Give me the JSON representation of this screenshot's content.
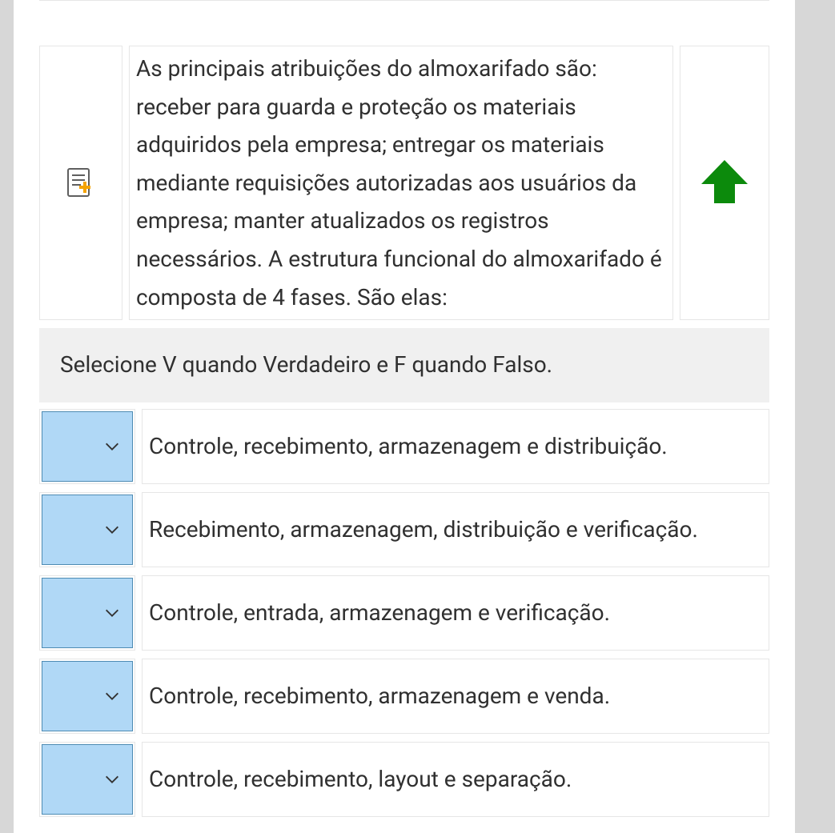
{
  "question": {
    "text": "As principais atribuições do almoxarifado são: receber para guarda e proteção os materiais adquiridos pela empresa; entregar os materiais mediante requisições autorizadas aos usuários da empresa; manter atualizados os registros necessários. A estrutura funcional do almoxarifado é composta de 4 fases. São elas:"
  },
  "instruction": "Selecione V quando Verdadeiro e F quando Falso.",
  "options": [
    {
      "text": "Controle, recebimento, armazenagem e distribuição."
    },
    {
      "text": "Recebimento, armazenagem, distribuição e verificação."
    },
    {
      "text": "Controle, entrada, armazenagem e verificação."
    },
    {
      "text": "Controle, recebimento, armazenagem e venda."
    },
    {
      "text": "Controle, recebimento, layout e separação."
    }
  ]
}
